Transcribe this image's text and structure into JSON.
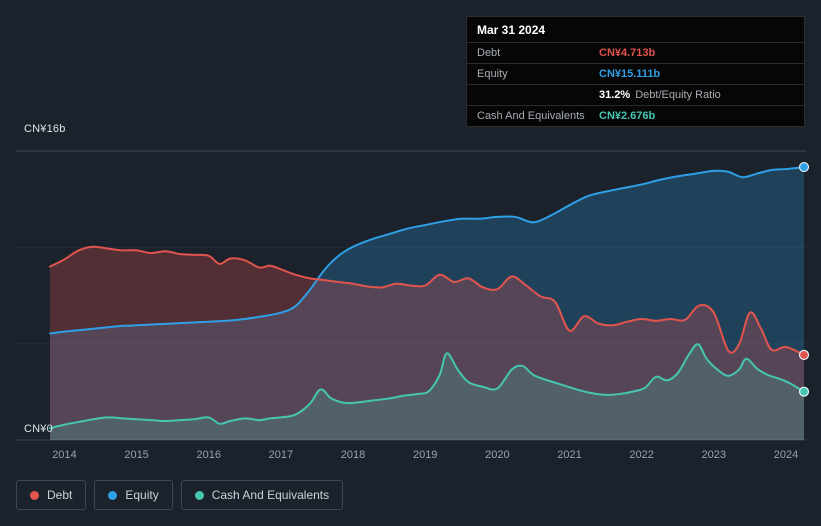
{
  "tooltip": {
    "date": "Mar 31 2024",
    "debt_label": "Debt",
    "debt_value": "CN¥4.713b",
    "equity_label": "Equity",
    "equity_value": "CN¥15.111b",
    "ratio_value": "31.2%",
    "ratio_label": "Debt/Equity Ratio",
    "cash_label": "Cash And Equivalents",
    "cash_value": "CN¥2.676b"
  },
  "axis": {
    "y_top_label": "CN¥16b",
    "y_bottom_label": "CN¥0"
  },
  "legend": {
    "debt": "Debt",
    "equity": "Equity",
    "cash": "Cash And Equivalents"
  },
  "colors": {
    "background": "#1b222b",
    "debt": "#e2544e",
    "equity": "#2f9fe6",
    "cash": "#46c6b1",
    "grid_strong": "#3d4653",
    "grid_faint": "#252d38",
    "axis_text": "#98a1ae"
  },
  "chart_data": {
    "type": "area",
    "unit": "CN¥ billions",
    "x_range": [
      2013.8,
      2024.25
    ],
    "y_range": [
      0,
      16
    ],
    "x_ticks": [
      "2014",
      "2015",
      "2016",
      "2017",
      "2018",
      "2019",
      "2020",
      "2021",
      "2022",
      "2023",
      "2024"
    ],
    "y_gridlines": [
      {
        "value": 16,
        "strong": true
      },
      {
        "value": 10.67,
        "strong": false
      },
      {
        "value": 5.33,
        "strong": false
      },
      {
        "value": 0,
        "strong": true
      }
    ],
    "legend_position": "bottom-left",
    "series": [
      {
        "id": "equity",
        "name": "Equity",
        "color": "#2f9fe6",
        "fill": "rgba(47,159,230,0.25)",
        "end_value_label": "CN¥15.111b",
        "points": [
          [
            2013.8,
            5.9
          ],
          [
            2014,
            6.0
          ],
          [
            2014.25,
            6.1
          ],
          [
            2014.5,
            6.2
          ],
          [
            2014.75,
            6.3
          ],
          [
            2015,
            6.35
          ],
          [
            2015.25,
            6.4
          ],
          [
            2015.5,
            6.45
          ],
          [
            2015.75,
            6.5
          ],
          [
            2016,
            6.55
          ],
          [
            2016.25,
            6.6
          ],
          [
            2016.5,
            6.7
          ],
          [
            2016.75,
            6.85
          ],
          [
            2017,
            7.05
          ],
          [
            2017.2,
            7.4
          ],
          [
            2017.4,
            8.3
          ],
          [
            2017.6,
            9.4
          ],
          [
            2017.8,
            10.2
          ],
          [
            2018,
            10.7
          ],
          [
            2018.25,
            11.1
          ],
          [
            2018.5,
            11.4
          ],
          [
            2018.75,
            11.7
          ],
          [
            2019,
            11.9
          ],
          [
            2019.25,
            12.1
          ],
          [
            2019.5,
            12.25
          ],
          [
            2019.75,
            12.25
          ],
          [
            2020,
            12.35
          ],
          [
            2020.25,
            12.35
          ],
          [
            2020.5,
            12.05
          ],
          [
            2020.75,
            12.45
          ],
          [
            2021,
            13.0
          ],
          [
            2021.25,
            13.5
          ],
          [
            2021.5,
            13.75
          ],
          [
            2021.75,
            13.95
          ],
          [
            2022,
            14.15
          ],
          [
            2022.25,
            14.4
          ],
          [
            2022.5,
            14.6
          ],
          [
            2022.75,
            14.75
          ],
          [
            2023,
            14.9
          ],
          [
            2023.2,
            14.85
          ],
          [
            2023.4,
            14.55
          ],
          [
            2023.6,
            14.75
          ],
          [
            2023.8,
            14.95
          ],
          [
            2024,
            15.0
          ],
          [
            2024.25,
            15.111
          ]
        ]
      },
      {
        "id": "debt",
        "name": "Debt",
        "color": "#e2544e",
        "fill": "rgba(226,84,78,0.28)",
        "end_value_label": "CN¥4.713b",
        "points": [
          [
            2013.8,
            9.6
          ],
          [
            2014,
            10.0
          ],
          [
            2014.2,
            10.5
          ],
          [
            2014.4,
            10.7
          ],
          [
            2014.6,
            10.6
          ],
          [
            2014.8,
            10.5
          ],
          [
            2015,
            10.5
          ],
          [
            2015.2,
            10.35
          ],
          [
            2015.4,
            10.45
          ],
          [
            2015.6,
            10.3
          ],
          [
            2015.8,
            10.25
          ],
          [
            2016,
            10.2
          ],
          [
            2016.15,
            9.75
          ],
          [
            2016.3,
            10.05
          ],
          [
            2016.5,
            9.95
          ],
          [
            2016.7,
            9.55
          ],
          [
            2016.85,
            9.65
          ],
          [
            2017,
            9.45
          ],
          [
            2017.2,
            9.15
          ],
          [
            2017.4,
            8.95
          ],
          [
            2017.6,
            8.85
          ],
          [
            2017.8,
            8.75
          ],
          [
            2018,
            8.65
          ],
          [
            2018.2,
            8.5
          ],
          [
            2018.4,
            8.45
          ],
          [
            2018.6,
            8.65
          ],
          [
            2018.8,
            8.55
          ],
          [
            2019,
            8.55
          ],
          [
            2019.2,
            9.15
          ],
          [
            2019.4,
            8.75
          ],
          [
            2019.6,
            8.95
          ],
          [
            2019.8,
            8.45
          ],
          [
            2020,
            8.35
          ],
          [
            2020.2,
            9.05
          ],
          [
            2020.4,
            8.55
          ],
          [
            2020.6,
            7.95
          ],
          [
            2020.8,
            7.65
          ],
          [
            2021,
            6.05
          ],
          [
            2021.2,
            6.85
          ],
          [
            2021.4,
            6.45
          ],
          [
            2021.6,
            6.35
          ],
          [
            2021.8,
            6.55
          ],
          [
            2022,
            6.7
          ],
          [
            2022.2,
            6.6
          ],
          [
            2022.4,
            6.7
          ],
          [
            2022.6,
            6.65
          ],
          [
            2022.8,
            7.45
          ],
          [
            2023,
            7.05
          ],
          [
            2023.2,
            4.95
          ],
          [
            2023.35,
            5.3
          ],
          [
            2023.5,
            7.05
          ],
          [
            2023.65,
            6.2
          ],
          [
            2023.8,
            5.0
          ],
          [
            2024,
            5.15
          ],
          [
            2024.25,
            4.713
          ]
        ]
      },
      {
        "id": "cash",
        "name": "Cash And Equivalents",
        "color": "#46c6b1",
        "fill": "rgba(70,198,177,0.22)",
        "end_value_label": "CN¥2.676b",
        "points": [
          [
            2013.8,
            0.65
          ],
          [
            2014,
            0.85
          ],
          [
            2014.2,
            1.0
          ],
          [
            2014.4,
            1.15
          ],
          [
            2014.6,
            1.25
          ],
          [
            2014.8,
            1.2
          ],
          [
            2015,
            1.15
          ],
          [
            2015.2,
            1.1
          ],
          [
            2015.4,
            1.05
          ],
          [
            2015.6,
            1.1
          ],
          [
            2015.8,
            1.15
          ],
          [
            2016,
            1.25
          ],
          [
            2016.15,
            0.9
          ],
          [
            2016.3,
            1.05
          ],
          [
            2016.5,
            1.2
          ],
          [
            2016.7,
            1.1
          ],
          [
            2016.85,
            1.2
          ],
          [
            2017,
            1.25
          ],
          [
            2017.2,
            1.4
          ],
          [
            2017.4,
            2.0
          ],
          [
            2017.55,
            2.8
          ],
          [
            2017.7,
            2.3
          ],
          [
            2017.9,
            2.05
          ],
          [
            2018.1,
            2.1
          ],
          [
            2018.3,
            2.2
          ],
          [
            2018.5,
            2.3
          ],
          [
            2018.7,
            2.45
          ],
          [
            2018.9,
            2.55
          ],
          [
            2019.05,
            2.7
          ],
          [
            2019.2,
            3.6
          ],
          [
            2019.3,
            4.8
          ],
          [
            2019.45,
            3.9
          ],
          [
            2019.6,
            3.2
          ],
          [
            2019.8,
            2.95
          ],
          [
            2020,
            2.85
          ],
          [
            2020.2,
            3.9
          ],
          [
            2020.35,
            4.1
          ],
          [
            2020.5,
            3.6
          ],
          [
            2020.7,
            3.3
          ],
          [
            2020.9,
            3.05
          ],
          [
            2021.1,
            2.8
          ],
          [
            2021.3,
            2.6
          ],
          [
            2021.5,
            2.5
          ],
          [
            2021.7,
            2.55
          ],
          [
            2021.9,
            2.7
          ],
          [
            2022.05,
            2.9
          ],
          [
            2022.2,
            3.5
          ],
          [
            2022.35,
            3.3
          ],
          [
            2022.5,
            3.7
          ],
          [
            2022.65,
            4.7
          ],
          [
            2022.78,
            5.3
          ],
          [
            2022.9,
            4.5
          ],
          [
            2023.05,
            3.9
          ],
          [
            2023.2,
            3.55
          ],
          [
            2023.35,
            3.9
          ],
          [
            2023.45,
            4.5
          ],
          [
            2023.6,
            3.95
          ],
          [
            2023.75,
            3.6
          ],
          [
            2023.9,
            3.4
          ],
          [
            2024.05,
            3.15
          ],
          [
            2024.25,
            2.676
          ]
        ]
      }
    ]
  }
}
